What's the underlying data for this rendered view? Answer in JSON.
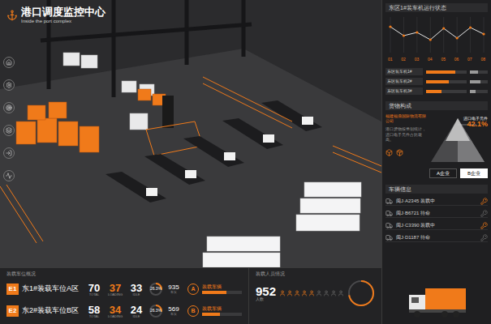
{
  "header": {
    "title": "港口调度监控中心",
    "subtitle": "Inside the port complex"
  },
  "machine_status": {
    "title": "东区1#装车机运行状态",
    "chart": {
      "x_labels": [
        "01",
        "02",
        "03",
        "04",
        "05",
        "06",
        "07",
        "08"
      ],
      "values": [
        62,
        40,
        48,
        30,
        58,
        34,
        60,
        44
      ],
      "max": 80
    },
    "rows": [
      {
        "label": "东区装车机1#",
        "level": 0.72,
        "secondary": 0.45
      },
      {
        "label": "东区装车机2#",
        "level": 0.55,
        "secondary": 0.6
      },
      {
        "label": "东区装车机3#",
        "level": 0.38,
        "secondary": 0.3
      }
    ]
  },
  "cargo": {
    "title": "货物构成",
    "company": "福建福鼎国际物流有限公司",
    "description": "港口货物按类别统计，进口电子元件占比最高。",
    "pyramid": {
      "label": "进口电子元件",
      "value": "42.1%"
    },
    "buttons": [
      {
        "label": "A企业",
        "selected": false
      },
      {
        "label": "B企业",
        "selected": true
      }
    ]
  },
  "vehicles": {
    "title": "车辆信息",
    "rows": [
      {
        "label": "闽J·A2345 装载中",
        "active": true
      },
      {
        "label": "闽J·B6721 待命",
        "active": false
      },
      {
        "label": "闽J·C3390 装载中",
        "active": true
      },
      {
        "label": "闽J·D1187 待命",
        "active": false
      }
    ]
  },
  "loading": {
    "title": "装载车位概况",
    "areas": [
      {
        "code": "E1",
        "name": "东1#装载车位A区",
        "stats": [
          {
            "value": "70",
            "label": "TOTAL",
            "highlight": false
          },
          {
            "value": "37",
            "label": "LOADING",
            "highlight": true
          },
          {
            "value": "33",
            "label": "IDLE",
            "highlight": false
          }
        ],
        "rate": "26.3%",
        "rate_level": 0.263,
        "count": "935",
        "count_label": "车次"
      },
      {
        "code": "E2",
        "name": "东2#装载车位B区",
        "stats": [
          {
            "value": "58",
            "label": "TOTAL",
            "highlight": false
          },
          {
            "value": "34",
            "label": "LOADING",
            "highlight": true
          },
          {
            "value": "24",
            "label": "IDLE",
            "highlight": false
          }
        ],
        "rate": "26.3%",
        "rate_level": 0.263,
        "count": "569",
        "count_label": "车次"
      }
    ],
    "vehicles": [
      {
        "code": "A",
        "label": "装载车辆",
        "level": 0.62
      },
      {
        "code": "B",
        "label": "装载车辆",
        "level": 0.45
      }
    ]
  },
  "personnel": {
    "title": "装载人员情况",
    "count": "952",
    "unit": "人数",
    "people": [
      {
        "active": true
      },
      {
        "active": true
      },
      {
        "active": true
      },
      {
        "active": true
      },
      {
        "active": true
      },
      {
        "active": false
      },
      {
        "active": false
      },
      {
        "active": false
      },
      {
        "active": false
      }
    ],
    "gauge_level": 0.72
  }
}
